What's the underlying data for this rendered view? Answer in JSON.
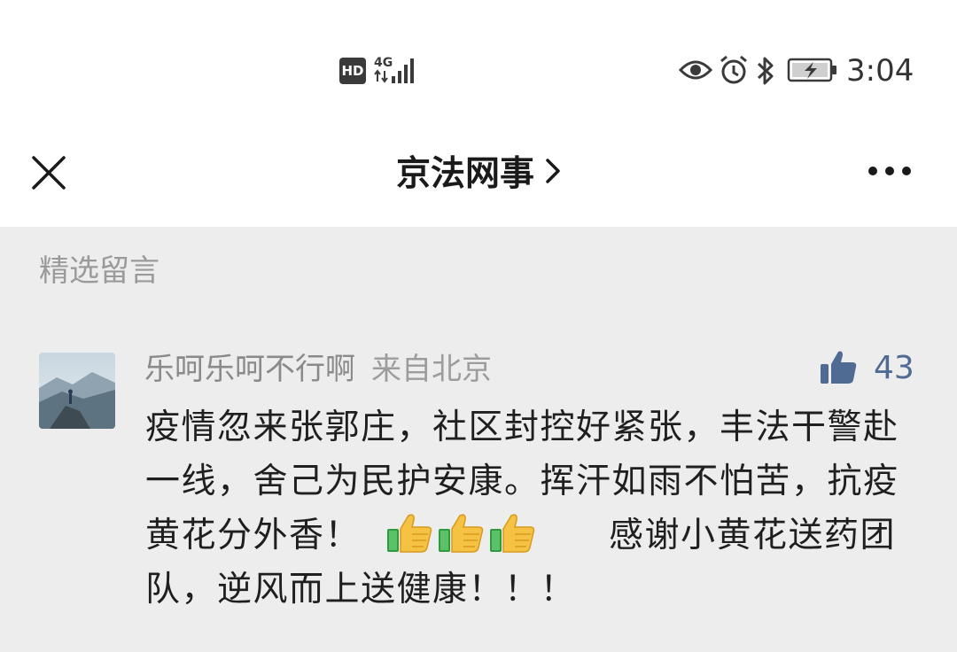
{
  "status_bar": {
    "hd_label": "HD",
    "network_label": "4G",
    "time": "3:04",
    "icons": [
      "hd-icon",
      "4g-signal-icon",
      "eye-icon",
      "alarm-icon",
      "bluetooth-icon",
      "battery-charging-icon"
    ]
  },
  "nav": {
    "title": "京法网事",
    "close_icon": "close-icon",
    "more_icon": "more-dots-icon",
    "chevron_icon": "chevron-right-icon"
  },
  "section": {
    "title": "精选留言"
  },
  "comments": [
    {
      "username": "乐呵乐呵不行啊",
      "location": "来自北京",
      "likes": "43",
      "text_part1": "疫情忽来张郭庄，社区封控好紧张，丰法干警赴一线，舍己为民护安康。挥汗如雨不怕苦，抗疫黄花分外香！",
      "emoji": "thumbs-up-emoji",
      "emoji_count": 3,
      "text_part2": "感谢小黄花送药团队，逆风而上送健康！！！"
    }
  ],
  "colors": {
    "content_bg": "#ededed",
    "link_blue": "#4f6a93",
    "secondary_text": "#8a8a8a"
  }
}
